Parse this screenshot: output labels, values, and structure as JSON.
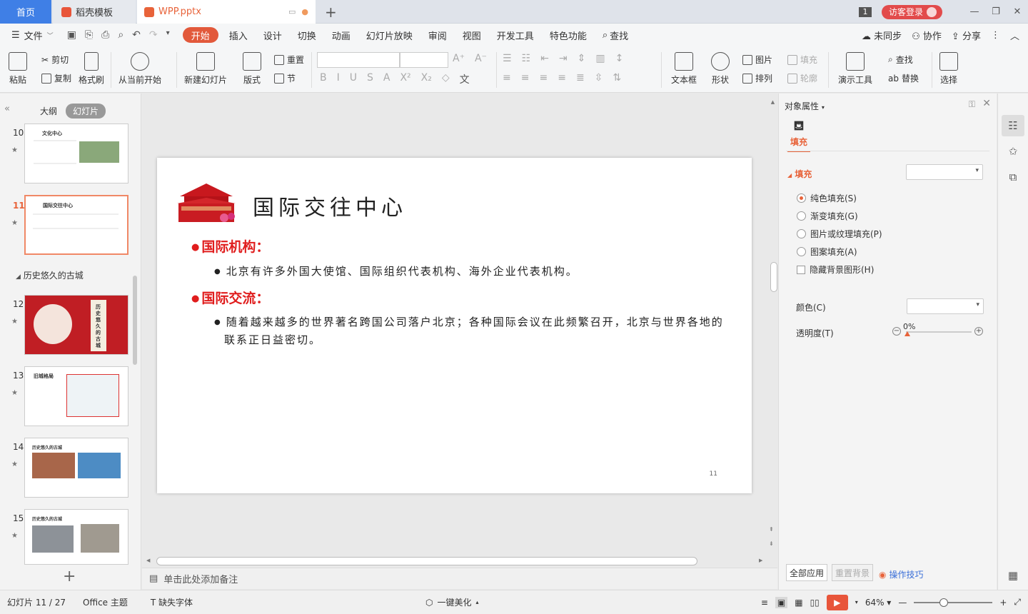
{
  "tabs": {
    "home": "首页",
    "template": "稻壳模板",
    "file": "WPP.pptx",
    "add": "+"
  },
  "window": {
    "badge": "1",
    "visitor_login": "访客登录",
    "minimize": "—",
    "restore": "❐",
    "close": "✕"
  },
  "menu": {
    "file": "文件",
    "items": [
      "开始",
      "插入",
      "设计",
      "切换",
      "动画",
      "幻灯片放映",
      "审阅",
      "视图",
      "开发工具",
      "特色功能"
    ],
    "search": "查找",
    "unsynced": "未同步",
    "collaborate": "协作",
    "share": "分享"
  },
  "ribbon": {
    "paste": "粘贴",
    "cut": "剪切",
    "copy": "复制",
    "format_painter": "格式刷",
    "play_from_current": "从当前开始",
    "new_slide": "新建幻灯片",
    "layout": "版式",
    "reset": "重置",
    "section": "节",
    "textbox": "文本框",
    "shape": "形状",
    "picture": "图片",
    "arrange": "排列",
    "fill": "填充",
    "outline": "轮廓",
    "presentation_tools": "演示工具",
    "find": "查找",
    "replace": "替换",
    "select": "选择"
  },
  "left_panel": {
    "outline_tab": "大纲",
    "slides_tab": "幻灯片",
    "section": "历史悠久的古城",
    "slide_numbers": [
      "10",
      "11",
      "12",
      "13",
      "14",
      "15"
    ],
    "thumb_titles": {
      "s10": "文化中心",
      "s11": "国际交往中心",
      "s12": "历史悠久的古城",
      "s13": "旧城格局",
      "s14": "历史悠久的古城",
      "s15": "历史悠久的古城"
    }
  },
  "slide": {
    "title": "国际交往中心",
    "h1": "国际机构：",
    "p1": "北京有许多外国大使馆、国际组织代表机构、海外企业代表机构。",
    "h2": "国际交流：",
    "p2": "随着越来越多的世界著名跨国公司落户北京；各种国际会议在此频繁召开，北京与世界各地的联系正日益密切。",
    "page_number": "11"
  },
  "notes": {
    "placeholder": "单击此处添加备注"
  },
  "properties": {
    "title": "对象属性",
    "fill_tab": "填充",
    "fill_section": "填充",
    "options": [
      "纯色填充(S)",
      "渐变填充(G)",
      "图片或纹理填充(P)",
      "图案填充(A)"
    ],
    "selected_option": "纯色填充(S)",
    "hide_bg": "隐藏背景图形(H)",
    "color_label": "颜色(C)",
    "transparency_label": "透明度(T)",
    "transparency_value": "0%",
    "apply_all": "全部应用",
    "reset_bg": "重置背景",
    "tips": "操作技巧"
  },
  "status": {
    "slide_count": "幻灯片 11 / 27",
    "theme": "Office 主题",
    "missing_font": "缺失字体",
    "beautify": "一键美化",
    "zoom": "64%"
  },
  "colors": {
    "accent": "#e8633a",
    "home_tab": "#3f7fe6",
    "slide_red": "#e01d1d"
  }
}
